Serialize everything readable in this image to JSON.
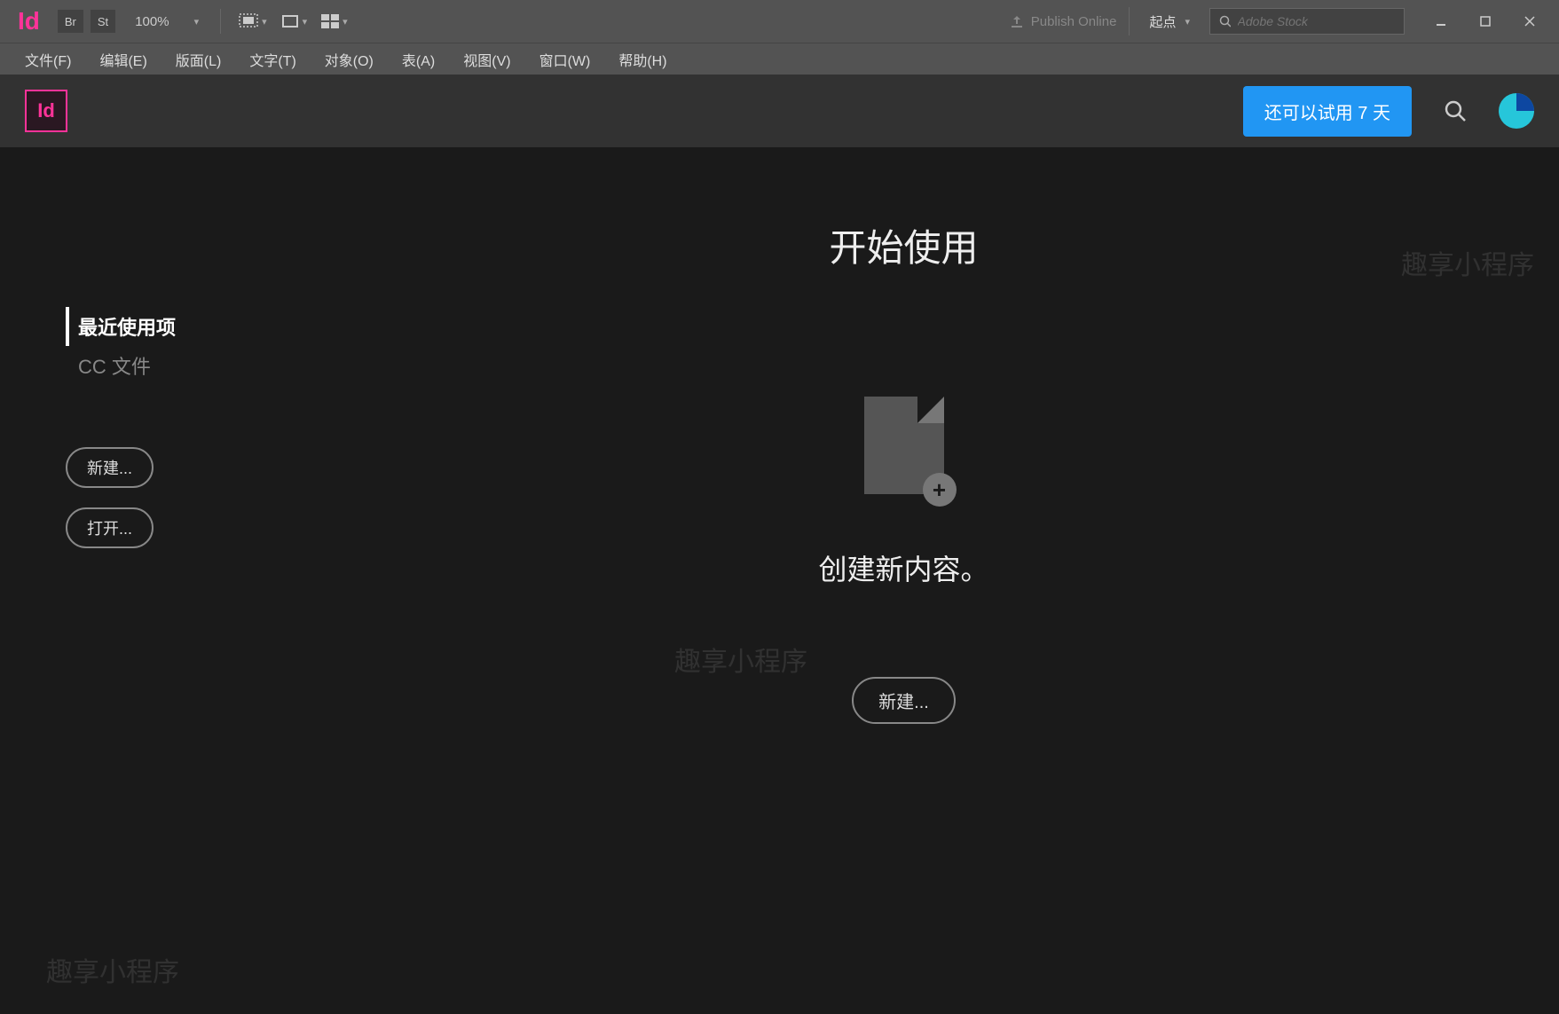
{
  "titlebar": {
    "app_logo": "Id",
    "br_label": "Br",
    "st_label": "St",
    "zoom": "100%",
    "publish_label": "Publish Online",
    "workspace": "起点",
    "search_placeholder": "Adobe Stock"
  },
  "menu": {
    "items": [
      "文件(F)",
      "编辑(E)",
      "版面(L)",
      "文字(T)",
      "对象(O)",
      "表(A)",
      "视图(V)",
      "窗口(W)",
      "帮助(H)"
    ]
  },
  "welcome_header": {
    "badge": "Id",
    "trial_label": "还可以试用 7 天"
  },
  "sidebar": {
    "nav": [
      {
        "label": "最近使用项",
        "active": true
      },
      {
        "label": "CC 文件",
        "active": false
      }
    ],
    "new_btn": "新建...",
    "open_btn": "打开..."
  },
  "center": {
    "title": "开始使用",
    "subtitle": "创建新内容。",
    "new_btn": "新建..."
  },
  "watermark": "趣享小程序"
}
